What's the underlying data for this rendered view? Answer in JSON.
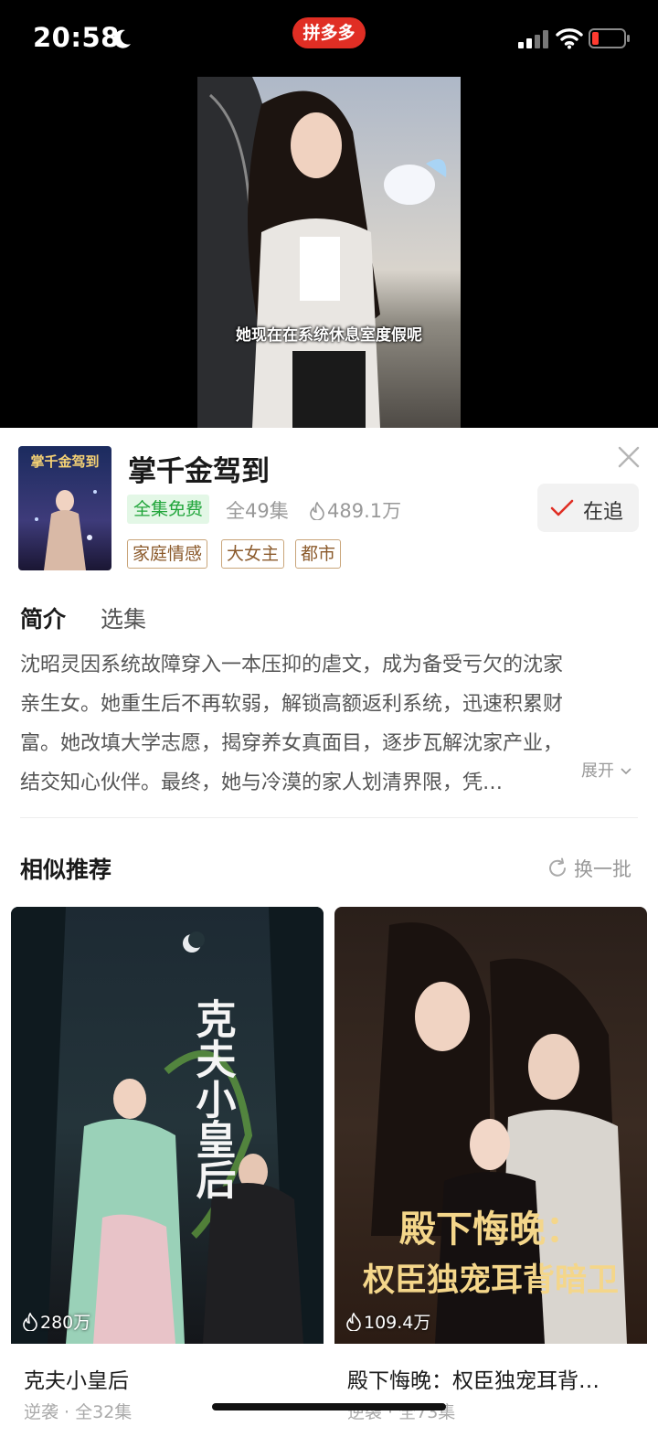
{
  "status_bar": {
    "time": "20:58",
    "app_badge": "拼多多"
  },
  "video": {
    "subtitle": "她现在在系统休息室度假呢"
  },
  "drama": {
    "cover_title_art": "掌千金驾到",
    "title": "掌千金驾到",
    "free_badge": "全集免费",
    "episodes": "全49集",
    "heat": "489.1万",
    "follow_label": "在追",
    "tags": [
      "家庭情感",
      "大女主",
      "都市"
    ]
  },
  "tabs": {
    "intro": "简介",
    "episodes": "选集"
  },
  "synopsis": {
    "lines": [
      "沈昭灵因系统故障穿入一本压抑的虐文，成为备受亏欠的沈家",
      "亲生女。她重生后不再软弱，解锁高额返利系统，迅速积累财",
      "富。她改填大学志愿，揭穿养女真面目，逐步瓦解沈家产业，",
      "结交知心伙伴。最终，她与冷漠的家人划清界限，凭…"
    ],
    "expand": "展开"
  },
  "recommendations": {
    "title": "相似推荐",
    "refresh": "换一批",
    "items": [
      {
        "poster_text": "克夫小皇后",
        "heat": "280万",
        "name": "克夫小皇后",
        "meta": "逆袭 · 全32集"
      },
      {
        "poster_line1": "殿下悔晚：",
        "poster_line2": "权臣独宠耳背暗卫",
        "heat": "109.4万",
        "name": "殿下悔晚：权臣独宠耳背…",
        "meta": "逆袭 · 全73集"
      }
    ]
  },
  "colors": {
    "brand_red": "#e02e24",
    "free_green": "#20a53a",
    "tag_brown": "#8b5a2b",
    "follow_check": "#e02e24"
  }
}
